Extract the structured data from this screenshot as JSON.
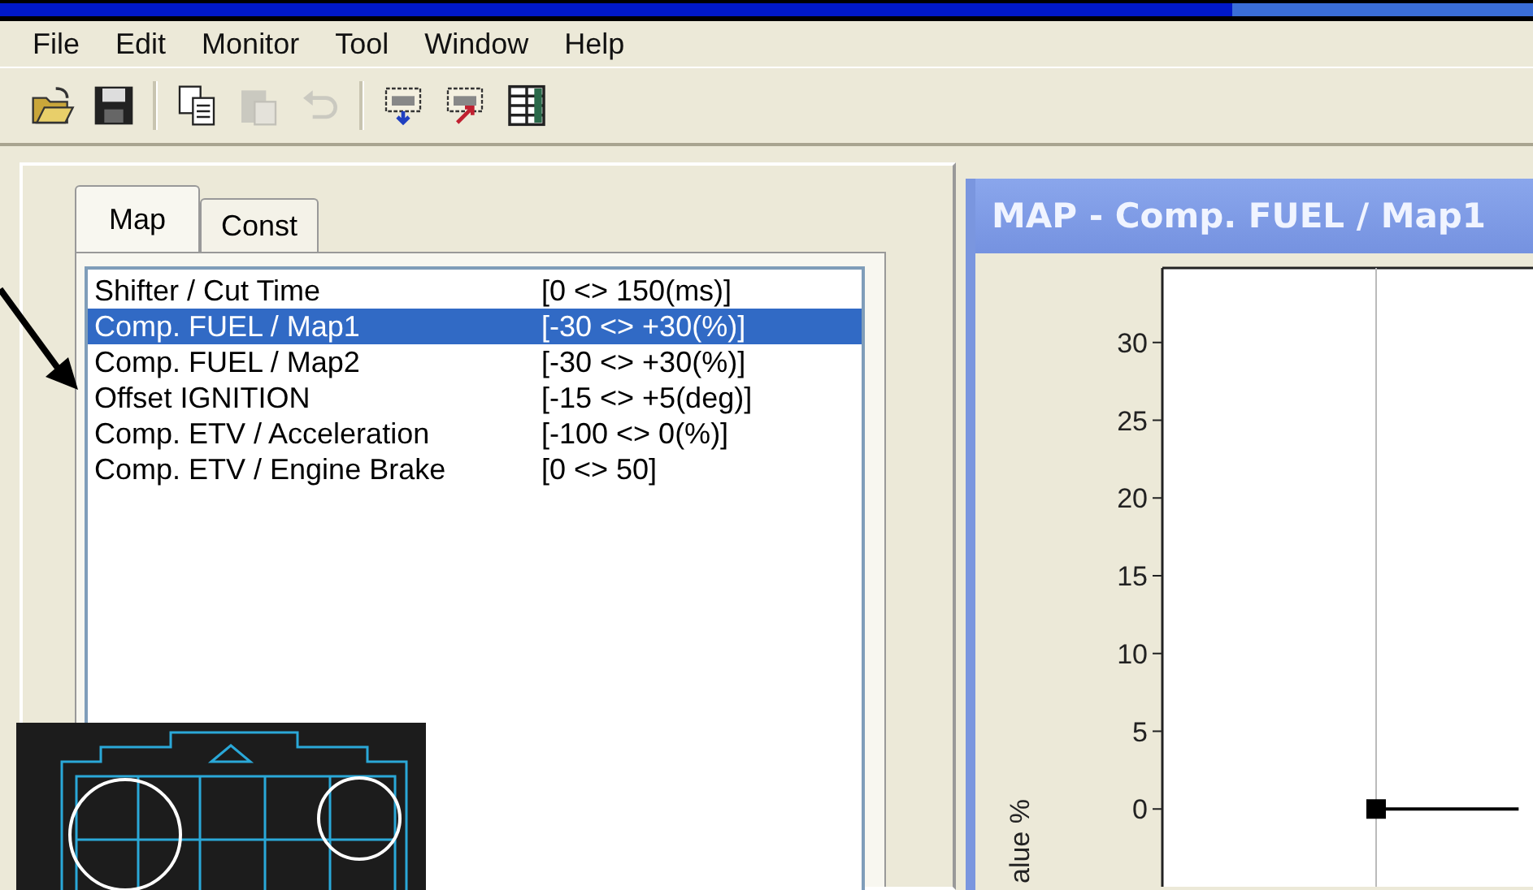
{
  "menu": [
    "File",
    "Edit",
    "Monitor",
    "Tool",
    "Window",
    "Help"
  ],
  "toolbar": [
    {
      "kind": "open",
      "disabled": false
    },
    {
      "kind": "save",
      "disabled": false
    },
    {
      "kind": "copy",
      "disabled": false
    },
    {
      "kind": "paste",
      "disabled": true
    },
    {
      "kind": "undo",
      "disabled": true
    },
    {
      "kind": "download",
      "disabled": false
    },
    {
      "kind": "upload",
      "disabled": false
    },
    {
      "kind": "grid",
      "disabled": false
    }
  ],
  "tabs": [
    {
      "label": "Map",
      "selected": true
    },
    {
      "label": "Const",
      "selected": false
    }
  ],
  "map_list": [
    {
      "name": "Shifter / Cut Time",
      "range": "[0 <> 150(ms)]",
      "selected": false
    },
    {
      "name": "Comp. FUEL / Map1",
      "range": "[-30 <> +30(%)]",
      "selected": true
    },
    {
      "name": "Comp. FUEL / Map2",
      "range": "[-30 <> +30(%)]",
      "selected": false
    },
    {
      "name": "Offset IGNITION",
      "range": "[-15 <> +5(deg)]",
      "selected": false
    },
    {
      "name": "Comp. ETV / Acceleration",
      "range": "[-100 <> 0(%)]",
      "selected": false
    },
    {
      "name": "Comp. ETV / Engine Brake",
      "range": "[0 <> 50]",
      "selected": false
    }
  ],
  "map_window": {
    "title": "MAP - Comp. FUEL / Map1",
    "chart_data": {
      "type": "line",
      "ylabel": "alue %",
      "categories": [
        null,
        null,
        null
      ],
      "ylim": [
        -5,
        35
      ],
      "yticks": [
        0,
        5,
        10,
        15,
        20,
        25,
        30
      ],
      "series": [
        {
          "color": "#000000",
          "values": [
            null,
            0,
            0
          ]
        }
      ]
    }
  }
}
